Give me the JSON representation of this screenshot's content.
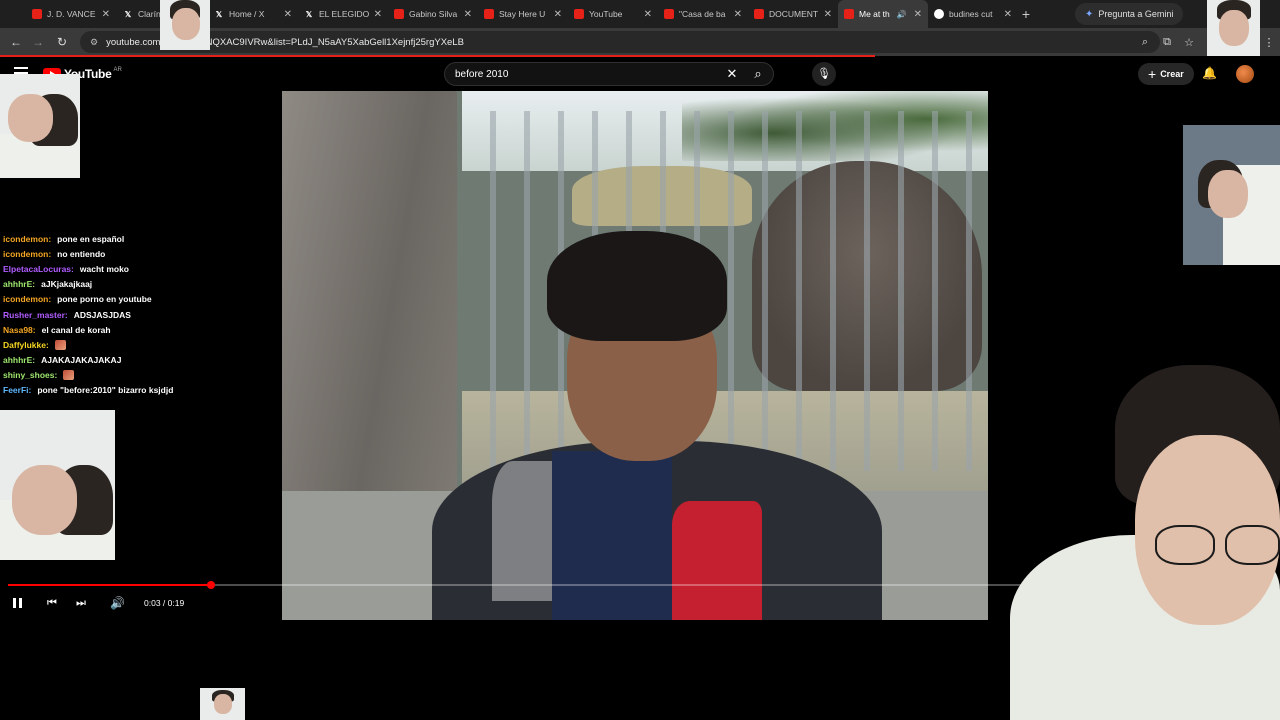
{
  "browser": {
    "tabs": [
      {
        "label": "J. D. VANCE",
        "favicon": "youtube",
        "active": false
      },
      {
        "label": "Clarín",
        "favicon": "x",
        "active": false
      },
      {
        "label": "Home / X",
        "favicon": "x",
        "active": false
      },
      {
        "label": "EL ELEGIDO",
        "favicon": "x",
        "active": false
      },
      {
        "label": "Gabino Silva",
        "favicon": "youtube",
        "active": false
      },
      {
        "label": "Stay Here U",
        "favicon": "youtube",
        "active": false
      },
      {
        "label": "YouTube",
        "favicon": "youtube",
        "active": false
      },
      {
        "label": "\"Casa de ba",
        "favicon": "youtube",
        "active": false
      },
      {
        "label": "DOCUMENT",
        "favicon": "youtube",
        "active": false
      },
      {
        "label": "Me at th",
        "favicon": "youtube",
        "active": true
      },
      {
        "label": "budines cut",
        "favicon": "google",
        "active": false
      }
    ],
    "gemini_label": "Pregunta a Gemini",
    "url": "youtube.com/watch?v=jNQXAC9IVRw&list=PLdJ_N5aAY5XabGell1Xejnfj25rgYXeLB"
  },
  "youtube": {
    "logo_text": "YouTube",
    "region": "AR",
    "search_value": "before 2010",
    "create_label": "Crear"
  },
  "player": {
    "current_time": "0:03",
    "duration": "0:19",
    "time_display": "0:03 / 0:19",
    "progress_fraction": 0.18
  },
  "chat": [
    {
      "user": "icondemon:",
      "message": "pone en español",
      "color": "#f5a623"
    },
    {
      "user": "icondemon:",
      "message": "no entiendo",
      "color": "#f5a623"
    },
    {
      "user": "ElpetacaLocuras:",
      "message": "wacht moko",
      "color": "#b05cff"
    },
    {
      "user": "ahhhrE:",
      "message": "aJKjakajkaaj",
      "color": "#9fe870"
    },
    {
      "user": "icondemon:",
      "message": "pone porno en youtube",
      "color": "#f5a623"
    },
    {
      "user": "Rusher_master:",
      "message": "ADSJASJDAS",
      "color": "#b05cff"
    },
    {
      "user": "Nasa98:",
      "message": "el canal de korah",
      "color": "#f5a623"
    },
    {
      "user": "Daffylukke:",
      "message": "",
      "color": "#f5d623",
      "emote": true
    },
    {
      "user": "ahhhrE:",
      "message": "AJAKAJAKAJAKAJ",
      "color": "#9fe870"
    },
    {
      "user": "shiny_shoes:",
      "message": "",
      "color": "#9fe870",
      "emote": true
    },
    {
      "user": "FeerFi:",
      "message": "pone \"before:2010\" bizarro ksjdjd",
      "color": "#5fb8ff"
    }
  ],
  "colors": {
    "youtube_red": "#ff0000",
    "progress_red": "#ff0000",
    "loadbar_red": "#e62117"
  }
}
